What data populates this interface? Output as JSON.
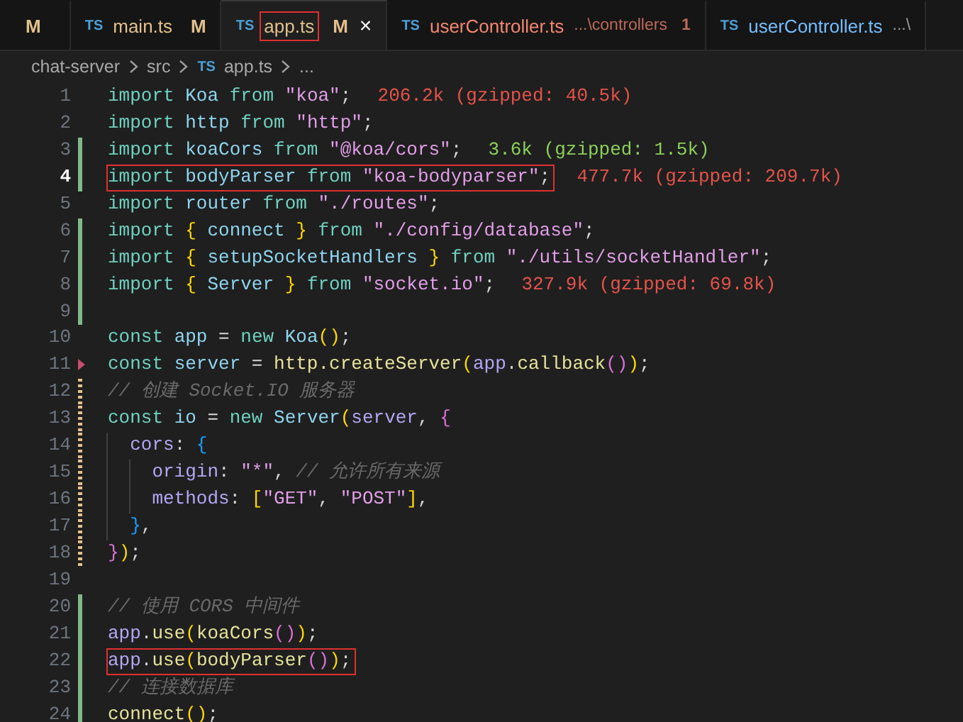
{
  "tabs": [
    {
      "status": "M",
      "kind": "modified",
      "selected": false
    },
    {
      "icon": "TS",
      "label": "main.ts",
      "status": "M",
      "kind": "modified",
      "selected": false,
      "boxed": false
    },
    {
      "icon": "TS",
      "label": "app.ts",
      "status": "M",
      "kind": "modified",
      "selected": true,
      "boxed": true,
      "close": "×"
    },
    {
      "icon": "TS",
      "label": "userController.ts",
      "description": "...\\controllers",
      "status": "1",
      "kind": "error",
      "selected": false,
      "boxed": false
    },
    {
      "icon": "TS",
      "label": "userController.ts",
      "description": "...\\",
      "kind": "plain",
      "selected": false,
      "boxed": false
    }
  ],
  "breadcrumb": [
    {
      "label": "chat-server"
    },
    {
      "label": "src"
    },
    {
      "icon": "TS",
      "label": "app.ts"
    },
    {
      "label": "..."
    }
  ],
  "lines": [
    {
      "number": "1",
      "kind": "plain",
      "current": false,
      "boxed": false,
      "tokens": [
        {
          "kind": "kw",
          "text": "import "
        },
        {
          "kind": "id",
          "text": "Koa "
        },
        {
          "kind": "kw",
          "text": "from "
        },
        {
          "kind": "str",
          "text": "\"koa\""
        },
        {
          "kind": "p",
          "text": ";"
        }
      ],
      "size_hint": {
        "kind": "large",
        "text": "206.2k (gzipped: 40.5k)"
      }
    },
    {
      "number": "2",
      "kind": "plain",
      "current": false,
      "boxed": false,
      "tokens": [
        {
          "kind": "kw",
          "text": "import "
        },
        {
          "kind": "id",
          "text": "http "
        },
        {
          "kind": "kw",
          "text": "from "
        },
        {
          "kind": "str",
          "text": "\"http\""
        },
        {
          "kind": "p",
          "text": ";"
        }
      ]
    },
    {
      "number": "3",
      "kind": "added",
      "current": false,
      "boxed": false,
      "tokens": [
        {
          "kind": "kw",
          "text": "import "
        },
        {
          "kind": "id",
          "text": "koaCors "
        },
        {
          "kind": "kw",
          "text": "from "
        },
        {
          "kind": "str",
          "text": "\"@koa/cors\""
        },
        {
          "kind": "p",
          "text": ";"
        }
      ],
      "size_hint": {
        "kind": "small",
        "text": "3.6k (gzipped: 1.5k)"
      }
    },
    {
      "number": "4",
      "kind": "added",
      "current": true,
      "boxed": true,
      "tokens": [
        {
          "kind": "kw",
          "text": "import "
        },
        {
          "kind": "id",
          "text": "bodyParser "
        },
        {
          "kind": "kw",
          "text": "from "
        },
        {
          "kind": "str",
          "text": "\"koa-bodyparser\""
        },
        {
          "kind": "p",
          "text": ";"
        }
      ],
      "size_hint": {
        "kind": "large",
        "text": "477.7k (gzipped: 209.7k)"
      }
    },
    {
      "number": "5",
      "kind": "plain",
      "current": false,
      "boxed": false,
      "tokens": [
        {
          "kind": "kw",
          "text": "import "
        },
        {
          "kind": "id",
          "text": "router "
        },
        {
          "kind": "kw",
          "text": "from "
        },
        {
          "kind": "str",
          "text": "\"./routes\""
        },
        {
          "kind": "p",
          "text": ";"
        }
      ]
    },
    {
      "number": "6",
      "kind": "added",
      "current": false,
      "boxed": false,
      "tokens": [
        {
          "kind": "kw",
          "text": "import "
        },
        {
          "kind": "b1",
          "text": "{ "
        },
        {
          "kind": "id",
          "text": "connect "
        },
        {
          "kind": "b1",
          "text": "} "
        },
        {
          "kind": "kw",
          "text": "from "
        },
        {
          "kind": "str",
          "text": "\"./config/database\""
        },
        {
          "kind": "p",
          "text": ";"
        }
      ]
    },
    {
      "number": "7",
      "kind": "added",
      "current": false,
      "boxed": false,
      "tokens": [
        {
          "kind": "kw",
          "text": "import "
        },
        {
          "kind": "b1",
          "text": "{ "
        },
        {
          "kind": "id",
          "text": "setupSocketHandlers "
        },
        {
          "kind": "b1",
          "text": "} "
        },
        {
          "kind": "kw",
          "text": "from "
        },
        {
          "kind": "str",
          "text": "\"./utils/socketHandler\""
        },
        {
          "kind": "p",
          "text": ";"
        }
      ]
    },
    {
      "number": "8",
      "kind": "added",
      "current": false,
      "boxed": false,
      "tokens": [
        {
          "kind": "kw",
          "text": "import "
        },
        {
          "kind": "b1",
          "text": "{ "
        },
        {
          "kind": "id",
          "text": "Server "
        },
        {
          "kind": "b1",
          "text": "} "
        },
        {
          "kind": "kw",
          "text": "from "
        },
        {
          "kind": "str",
          "text": "\"socket.io\""
        },
        {
          "kind": "p",
          "text": ";"
        }
      ],
      "size_hint": {
        "kind": "large",
        "text": "327.9k (gzipped: 69.8k)"
      }
    },
    {
      "number": "9",
      "kind": "added",
      "current": false
    },
    {
      "number": "10",
      "kind": "plain",
      "current": false,
      "boxed": false,
      "tokens": [
        {
          "kind": "kw",
          "text": "const "
        },
        {
          "kind": "id",
          "text": "app "
        },
        {
          "kind": "p",
          "text": "= "
        },
        {
          "kind": "kw",
          "text": "new "
        },
        {
          "kind": "id",
          "text": "Koa"
        },
        {
          "kind": "b1",
          "text": "()"
        },
        {
          "kind": "p",
          "text": ";"
        }
      ]
    },
    {
      "number": "11",
      "kind": "deleted",
      "current": false,
      "boxed": false,
      "tokens": [
        {
          "kind": "kw",
          "text": "const "
        },
        {
          "kind": "id",
          "text": "server "
        },
        {
          "kind": "p",
          "text": "= "
        },
        {
          "kind": "fn",
          "text": "http.createServer"
        },
        {
          "kind": "b1",
          "text": "("
        },
        {
          "kind": "var",
          "text": "app"
        },
        {
          "kind": "p",
          "text": "."
        },
        {
          "kind": "fn",
          "text": "callback"
        },
        {
          "kind": "b2",
          "text": "()"
        },
        {
          "kind": "b1",
          "text": ")"
        },
        {
          "kind": "p",
          "text": ";"
        }
      ]
    },
    {
      "number": "12",
      "kind": "modified",
      "current": false,
      "boxed": false,
      "tokens": [
        {
          "kind": "cm",
          "text": "// 创建 Socket.IO 服务器"
        }
      ]
    },
    {
      "number": "13",
      "kind": "modified",
      "current": false,
      "boxed": false,
      "tokens": [
        {
          "kind": "kw",
          "text": "const "
        },
        {
          "kind": "id",
          "text": "io "
        },
        {
          "kind": "p",
          "text": "= "
        },
        {
          "kind": "kw",
          "text": "new "
        },
        {
          "kind": "id",
          "text": "Server"
        },
        {
          "kind": "b1",
          "text": "("
        },
        {
          "kind": "var",
          "text": "server"
        },
        {
          "kind": "p",
          "text": ", "
        },
        {
          "kind": "b2",
          "text": "{"
        }
      ]
    },
    {
      "number": "14",
      "kind": "modified",
      "current": false,
      "boxed": false,
      "tokens": [
        {
          "kind": "prop",
          "text": "  cors"
        },
        {
          "kind": "p",
          "text": ": "
        },
        {
          "kind": "b3",
          "text": "{"
        }
      ]
    },
    {
      "number": "15",
      "kind": "modified",
      "current": false,
      "boxed": false,
      "tokens": [
        {
          "kind": "prop",
          "text": "    origin"
        },
        {
          "kind": "p",
          "text": ": "
        },
        {
          "kind": "str",
          "text": "\"*\""
        },
        {
          "kind": "p",
          "text": ", "
        },
        {
          "kind": "cm",
          "text": "// 允许所有来源"
        }
      ]
    },
    {
      "number": "16",
      "kind": "modified",
      "current": false,
      "boxed": false,
      "tokens": [
        {
          "kind": "prop",
          "text": "    methods"
        },
        {
          "kind": "p",
          "text": ": "
        },
        {
          "kind": "b1",
          "text": "["
        },
        {
          "kind": "str",
          "text": "\"GET\""
        },
        {
          "kind": "p",
          "text": ", "
        },
        {
          "kind": "str",
          "text": "\"POST\""
        },
        {
          "kind": "b1",
          "text": "]"
        },
        {
          "kind": "p",
          "text": ","
        }
      ]
    },
    {
      "number": "17",
      "kind": "modified",
      "current": false,
      "boxed": false,
      "tokens": [
        {
          "kind": "b3",
          "text": "  }"
        },
        {
          "kind": "p",
          "text": ","
        }
      ]
    },
    {
      "number": "18",
      "kind": "modified",
      "current": false,
      "boxed": false,
      "tokens": [
        {
          "kind": "b2",
          "text": "}"
        },
        {
          "kind": "b1",
          "text": ")"
        },
        {
          "kind": "p",
          "text": ";"
        }
      ]
    },
    {
      "number": "19",
      "kind": "plain",
      "current": false
    },
    {
      "number": "20",
      "kind": "added",
      "current": false,
      "boxed": false,
      "tokens": [
        {
          "kind": "cm",
          "text": "// 使用 CORS 中间件"
        }
      ]
    },
    {
      "number": "21",
      "kind": "added",
      "current": false,
      "boxed": false,
      "tokens": [
        {
          "kind": "var",
          "text": "app"
        },
        {
          "kind": "p",
          "text": "."
        },
        {
          "kind": "fn",
          "text": "use"
        },
        {
          "kind": "b1",
          "text": "("
        },
        {
          "kind": "fn",
          "text": "koaCors"
        },
        {
          "kind": "b2",
          "text": "()"
        },
        {
          "kind": "b1",
          "text": ")"
        },
        {
          "kind": "p",
          "text": ";"
        }
      ]
    },
    {
      "number": "22",
      "kind": "added",
      "current": false,
      "boxed": true,
      "tokens": [
        {
          "kind": "var",
          "text": "app"
        },
        {
          "kind": "p",
          "text": "."
        },
        {
          "kind": "fn",
          "text": "use"
        },
        {
          "kind": "b1",
          "text": "("
        },
        {
          "kind": "fn",
          "text": "bodyParser"
        },
        {
          "kind": "b2",
          "text": "()"
        },
        {
          "kind": "b1",
          "text": ")"
        },
        {
          "kind": "p",
          "text": ";"
        }
      ]
    },
    {
      "number": "23",
      "kind": "added",
      "current": false,
      "boxed": false,
      "tokens": [
        {
          "kind": "cm",
          "text": "// 连接数据库"
        }
      ]
    },
    {
      "number": "24",
      "kind": "added",
      "current": false,
      "boxed": false,
      "tokens": [
        {
          "kind": "fn",
          "text": "connect"
        },
        {
          "kind": "b1",
          "text": "()"
        },
        {
          "kind": "p",
          "text": ";"
        }
      ]
    }
  ]
}
